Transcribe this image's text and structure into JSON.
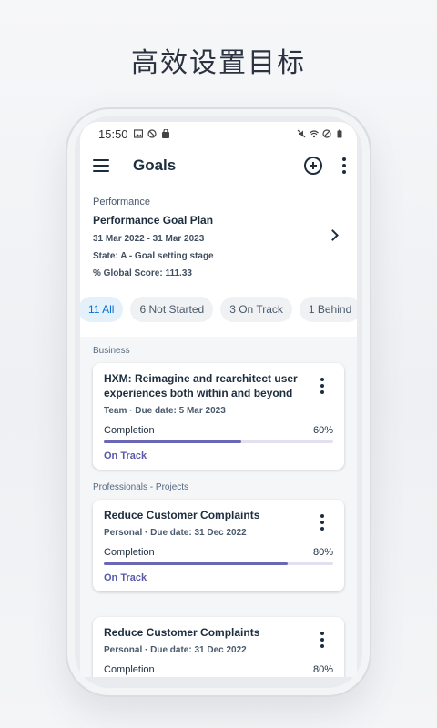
{
  "headline": "高效设置目标",
  "status_bar": {
    "time": "15:50"
  },
  "app_bar": {
    "title": "Goals",
    "menu_icon": "hamburger-icon",
    "add_icon": "add-circle-icon",
    "more_icon": "more-vertical-icon"
  },
  "plan": {
    "category": "Performance",
    "name": "Performance Goal Plan",
    "dates": "31 Mar 2022 - 31 Mar 2023",
    "state": "State: A - Goal setting stage",
    "score": "% Global Score: 111.33"
  },
  "filters": [
    {
      "label": "11 All",
      "active": true
    },
    {
      "label": "6 Not Started",
      "active": false
    },
    {
      "label": "3 On Track",
      "active": false
    },
    {
      "label": "1 Behind",
      "active": false
    }
  ],
  "sections": [
    {
      "label": "Business",
      "goals": [
        {
          "title": "HXM: Reimagine and rearchitect user experiences both within and beyond",
          "meta": "Team · Due date: 5 Mar 2023",
          "completion_label": "Completion",
          "completion": "60%",
          "completion_value": 0.6,
          "status": "On Track"
        }
      ]
    },
    {
      "label": "Professionals - Projects",
      "goals": [
        {
          "title": "Reduce Customer Complaints",
          "meta": "Personal · Due date: 31 Dec 2022",
          "completion_label": "Completion",
          "completion": "80%",
          "completion_value": 0.8,
          "status": "On Track"
        },
        {
          "title": "Reduce Customer Complaints",
          "meta": "Personal · Due date: 31 Dec 2022",
          "completion_label": "Completion",
          "completion": "80%",
          "completion_value": 0.8,
          "status": ""
        }
      ]
    }
  ],
  "colors": {
    "accent": "#0a6ed1",
    "progress": "#6a68b4",
    "status_text": "#5a59a8"
  }
}
